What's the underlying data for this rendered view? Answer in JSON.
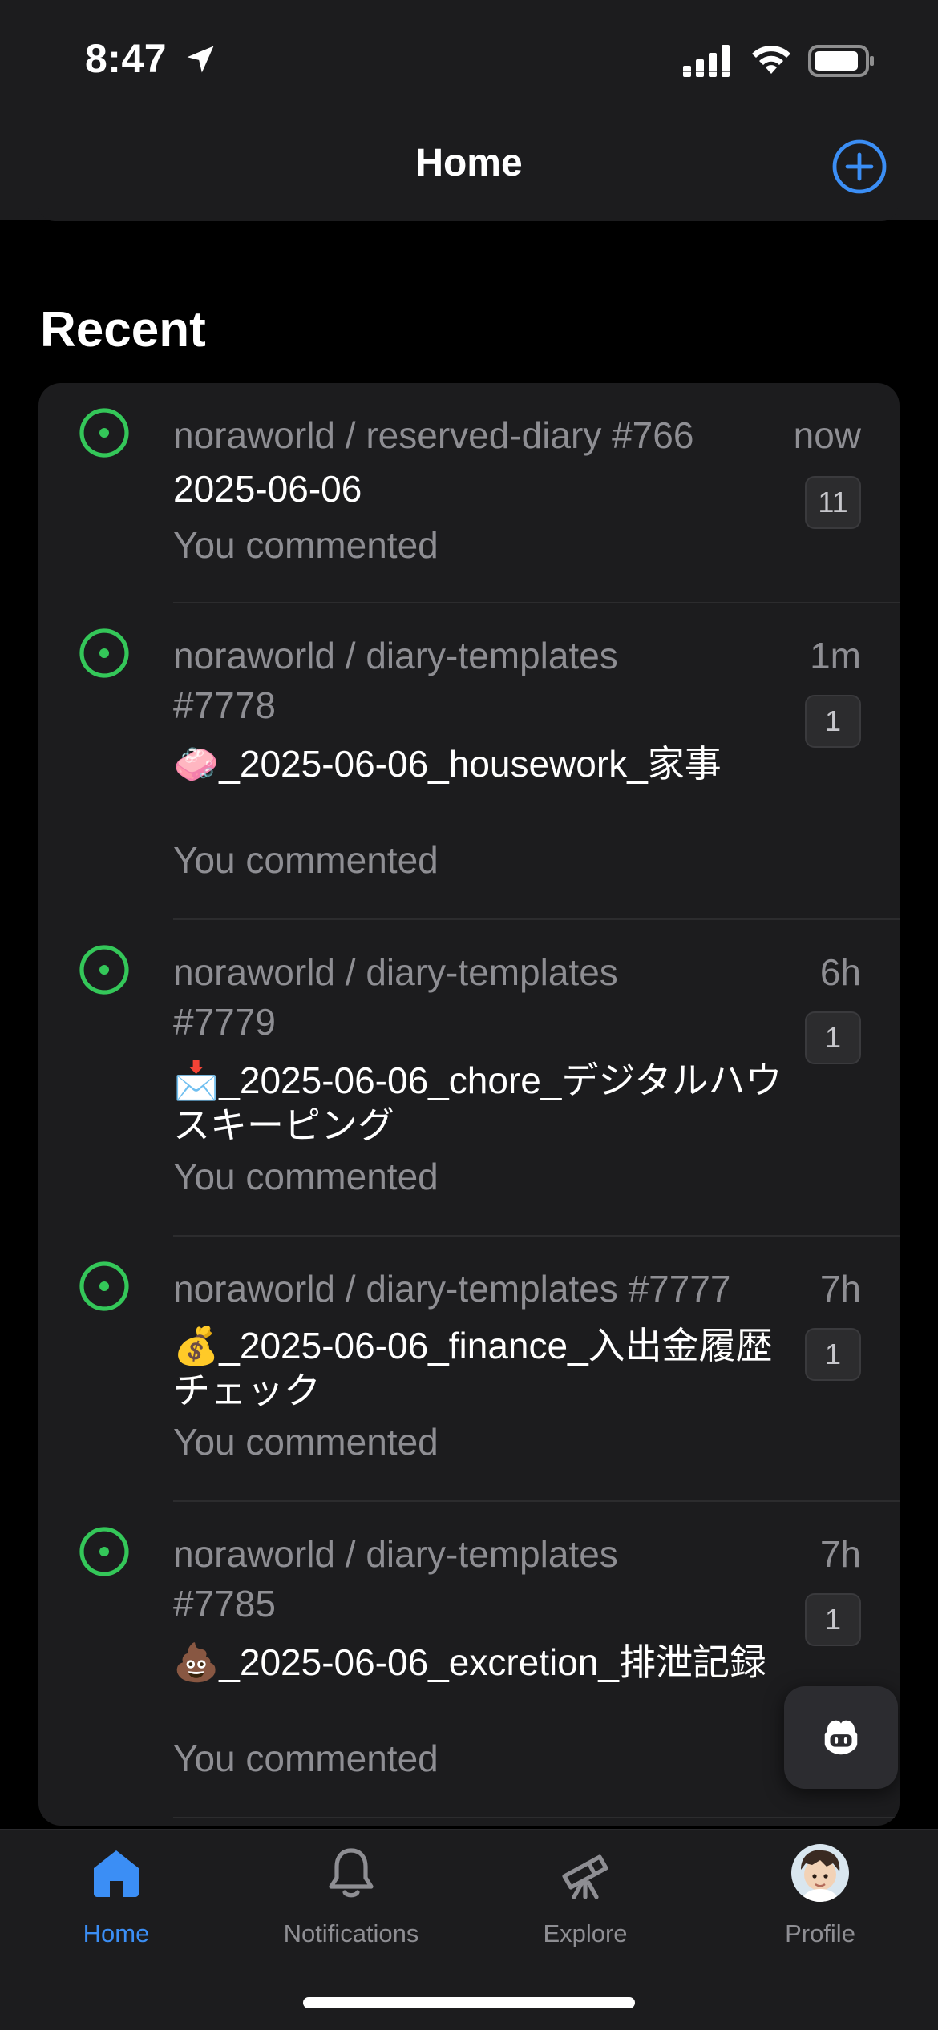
{
  "status_bar": {
    "time": "8:47"
  },
  "nav": {
    "title": "Home",
    "add_icon": "plus-circle-icon"
  },
  "recent": {
    "section_title": "Recent",
    "items": [
      {
        "repo": "noraworld / reserved-diary #766",
        "title": "2025-06-06",
        "subtitle": "You commented",
        "time": "now",
        "count": "11",
        "status_icon": "open-issue-icon"
      },
      {
        "repo": "noraworld / diary-templates #7778",
        "title": "🧼_2025-06-06_housework_家事",
        "subtitle": "You commented",
        "time": "1m",
        "count": "1",
        "status_icon": "open-issue-icon"
      },
      {
        "repo": "noraworld / diary-templates #7779",
        "title": "📩_2025-06-06_chore_デジタルハウスキーピング",
        "subtitle": "You commented",
        "time": "6h",
        "count": "1",
        "status_icon": "open-issue-icon"
      },
      {
        "repo": "noraworld / diary-templates #7777",
        "title": "💰_2025-06-06_finance_入出金履歴チェック",
        "subtitle": "You commented",
        "time": "7h",
        "count": "1",
        "status_icon": "open-issue-icon"
      },
      {
        "repo": "noraworld / diary-templates #7785",
        "title": "💩_2025-06-06_excretion_排泄記録",
        "subtitle": "You commented",
        "time": "7h",
        "count": "1",
        "status_icon": "open-issue-icon"
      }
    ]
  },
  "copilot_button": {
    "icon": "copilot-icon"
  },
  "tab_bar": {
    "tabs": [
      {
        "label": "Home",
        "icon": "home-icon",
        "active": true
      },
      {
        "label": "Notifications",
        "icon": "bell-icon",
        "active": false
      },
      {
        "label": "Explore",
        "icon": "telescope-icon",
        "active": false
      },
      {
        "label": "Profile",
        "icon": "avatar",
        "active": false
      }
    ]
  },
  "colors": {
    "accent": "#3b8ef5",
    "open_green": "#34c759",
    "background": "#000000",
    "surface": "#1c1c1e",
    "secondary_text": "#8e8e93"
  }
}
